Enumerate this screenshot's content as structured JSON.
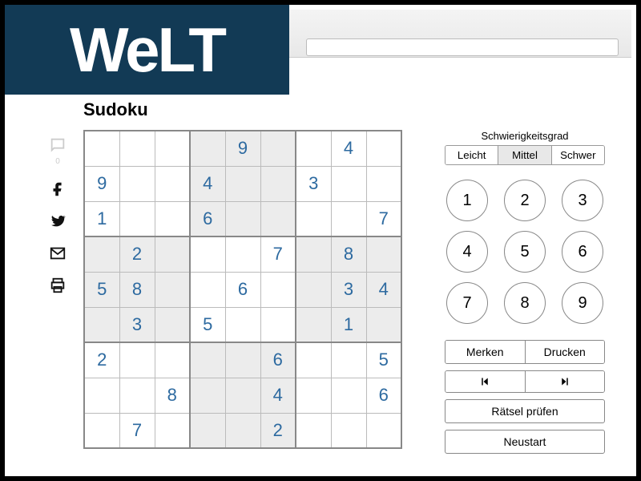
{
  "logo": "WeLT",
  "title": "Sudoku",
  "share": {
    "comment_count": "0"
  },
  "grid": [
    [
      "",
      "",
      "",
      "",
      "9",
      "",
      "",
      "4",
      ""
    ],
    [
      "9",
      "",
      "",
      "4",
      "",
      "",
      "3",
      "",
      ""
    ],
    [
      "1",
      "",
      "",
      "6",
      "",
      "",
      "",
      "",
      "7"
    ],
    [
      "",
      "2",
      "",
      "",
      "",
      "7",
      "",
      "8",
      ""
    ],
    [
      "5",
      "8",
      "",
      "",
      "6",
      "",
      "",
      "3",
      "4"
    ],
    [
      "",
      "3",
      "",
      "5",
      "",
      "",
      "",
      "1",
      ""
    ],
    [
      "2",
      "",
      "",
      "",
      "",
      "6",
      "",
      "",
      "5"
    ],
    [
      "",
      "",
      "8",
      "",
      "",
      "4",
      "",
      "",
      "6"
    ],
    [
      "",
      "7",
      "",
      "",
      "",
      "2",
      "",
      "",
      ""
    ]
  ],
  "difficulty": {
    "label": "Schwierigkeitsgrad",
    "options": [
      "Leicht",
      "Mittel",
      "Schwer"
    ],
    "active": 1
  },
  "numpad": [
    "1",
    "2",
    "3",
    "4",
    "5",
    "6",
    "7",
    "8",
    "9"
  ],
  "buttons": {
    "merken": "Merken",
    "drucken": "Drucken",
    "pruefen": "Rätsel prüfen",
    "neustart": "Neustart"
  }
}
